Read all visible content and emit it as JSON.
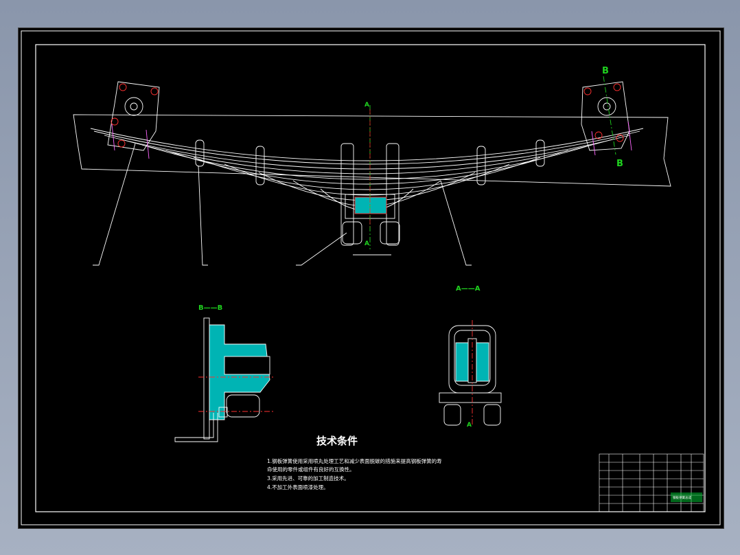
{
  "section_labels": {
    "b_top": "B",
    "b_bottom": "B",
    "a_top": "A",
    "a_bottom": "A",
    "view_aa": "A——A",
    "view_bb": "B——B",
    "a_small": "A"
  },
  "tech_requirements": {
    "title": "技术条件",
    "lines": [
      "1.钢板弹簧使用采用喷丸处理工艺和减少表面脱碳的措施来提高钢板弹簧的寿",
      "  命使用的零件或组件有良好的互换性。",
      "3.采用先进、可靠的加工制造技术。",
      "4.不加工外表面喷漆处理。"
    ]
  },
  "title_block": {
    "name": "钢板弹簧总成"
  },
  "colors": {
    "background": "#000000",
    "lines": "#ffffff",
    "highlight": "#ff2a2a",
    "section_fill": "#00c0c0",
    "labels": "#1fd21f",
    "hidden": "#ff66ff"
  }
}
